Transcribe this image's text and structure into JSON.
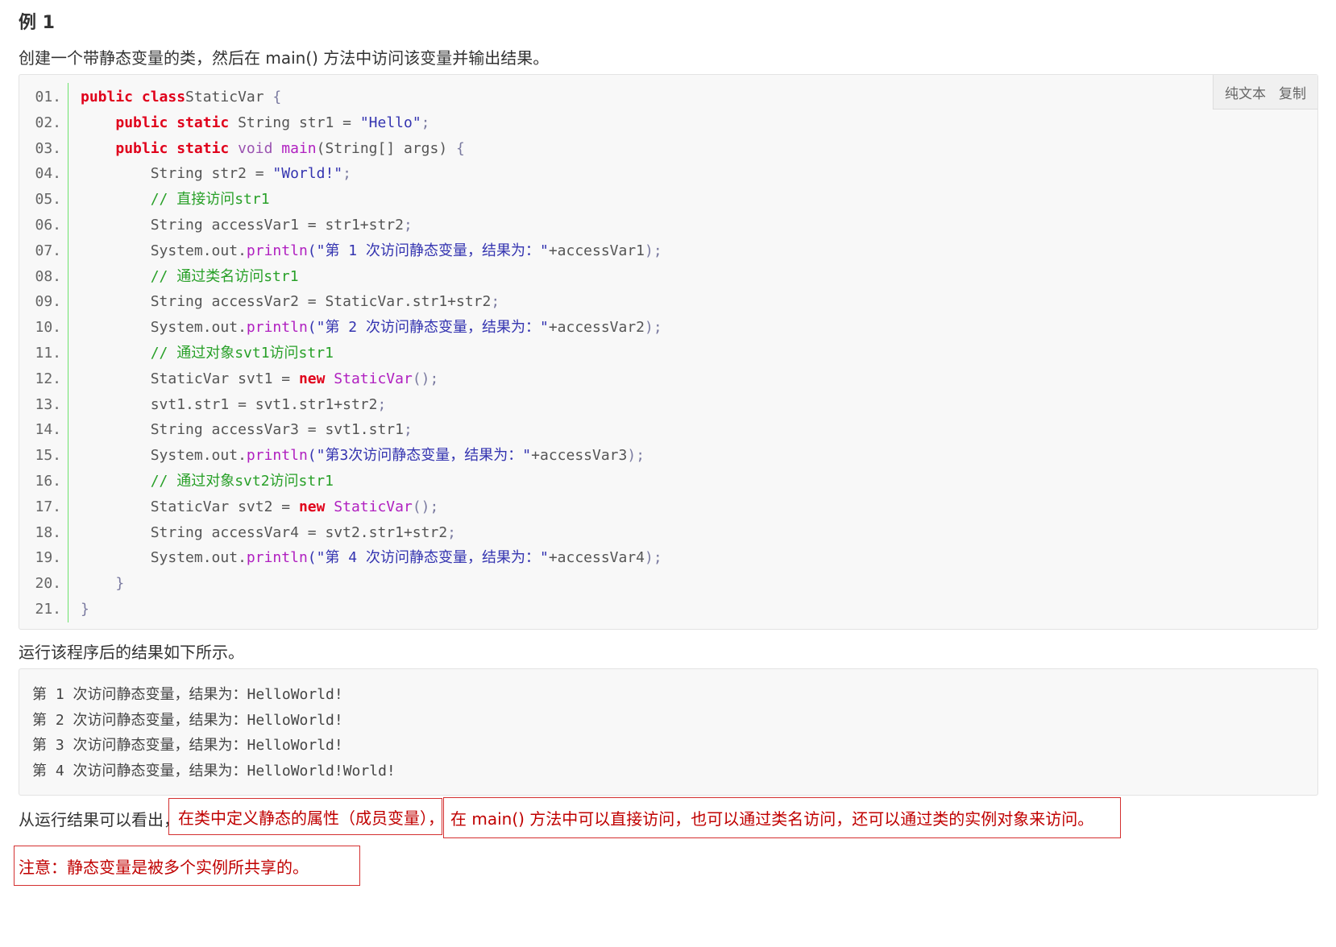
{
  "heading": "例 1",
  "intro": "创建一个带静态变量的类，然后在 main() 方法中访问该变量并输出结果。",
  "toolbar": {
    "plain": "纯文本",
    "copy": "复制"
  },
  "code_lines": [
    {
      "n": "01.",
      "indent": "",
      "tokens": [
        [
          "kw",
          "public class"
        ],
        [
          "",
          "StaticVar "
        ],
        [
          "pu",
          "{"
        ]
      ]
    },
    {
      "n": "02.",
      "indent": "    ",
      "tokens": [
        [
          "kw",
          "public static"
        ],
        [
          "",
          " String str1 = "
        ],
        [
          "st",
          "\"Hello\""
        ],
        [
          "pu",
          ";"
        ]
      ]
    },
    {
      "n": "03.",
      "indent": "    ",
      "tokens": [
        [
          "kw",
          "public static"
        ],
        [
          "ty",
          " void "
        ],
        [
          "fn",
          "main"
        ],
        [
          "",
          "(String[] args) "
        ],
        [
          "pu",
          "{"
        ]
      ]
    },
    {
      "n": "04.",
      "indent": "        ",
      "tokens": [
        [
          "",
          "String str2 = "
        ],
        [
          "st",
          "\"World!\""
        ],
        [
          "pu",
          ";"
        ]
      ]
    },
    {
      "n": "05.",
      "indent": "        ",
      "tokens": [
        [
          "cm",
          "// 直接访问str1"
        ]
      ]
    },
    {
      "n": "06.",
      "indent": "        ",
      "tokens": [
        [
          "",
          "String accessVar1 = str1+str2"
        ],
        [
          "pu",
          ";"
        ]
      ]
    },
    {
      "n": "07.",
      "indent": "        ",
      "tokens": [
        [
          "",
          "System.out."
        ],
        [
          "fn",
          "println"
        ],
        [
          "st",
          "(\"第 1 次访问静态变量，结果为：\""
        ],
        [
          "",
          "+accessVar1"
        ],
        [
          "pu",
          ");"
        ]
      ]
    },
    {
      "n": "08.",
      "indent": "        ",
      "tokens": [
        [
          "cm",
          "// 通过类名访问str1"
        ]
      ]
    },
    {
      "n": "09.",
      "indent": "        ",
      "tokens": [
        [
          "",
          "String accessVar2 = StaticVar.str1+str2"
        ],
        [
          "pu",
          ";"
        ]
      ]
    },
    {
      "n": "10.",
      "indent": "        ",
      "tokens": [
        [
          "",
          "System.out."
        ],
        [
          "fn",
          "println"
        ],
        [
          "st",
          "(\"第 2 次访问静态变量，结果为：\""
        ],
        [
          "",
          "+accessVar2"
        ],
        [
          "pu",
          ");"
        ]
      ]
    },
    {
      "n": "11.",
      "indent": "        ",
      "tokens": [
        [
          "cm",
          "// 通过对象svt1访问str1"
        ]
      ]
    },
    {
      "n": "12.",
      "indent": "        ",
      "tokens": [
        [
          "",
          "StaticVar svt1 = "
        ],
        [
          "kw",
          "new"
        ],
        [
          "fn",
          " StaticVar"
        ],
        [
          "pu",
          "();"
        ]
      ]
    },
    {
      "n": "13.",
      "indent": "        ",
      "tokens": [
        [
          "",
          "svt1.str1 = svt1.str1+str2"
        ],
        [
          "pu",
          ";"
        ]
      ]
    },
    {
      "n": "14.",
      "indent": "        ",
      "tokens": [
        [
          "",
          "String accessVar3 = svt1.str1"
        ],
        [
          "pu",
          ";"
        ]
      ]
    },
    {
      "n": "15.",
      "indent": "        ",
      "tokens": [
        [
          "",
          "System.out."
        ],
        [
          "fn",
          "println"
        ],
        [
          "st",
          "(\"第3次访问静态变量，结果为：\""
        ],
        [
          "",
          "+accessVar3"
        ],
        [
          "pu",
          ");"
        ]
      ]
    },
    {
      "n": "16.",
      "indent": "        ",
      "tokens": [
        [
          "cm",
          "// 通过对象svt2访问str1"
        ]
      ]
    },
    {
      "n": "17.",
      "indent": "        ",
      "tokens": [
        [
          "",
          "StaticVar svt2 = "
        ],
        [
          "kw",
          "new"
        ],
        [
          "fn",
          " StaticVar"
        ],
        [
          "pu",
          "();"
        ]
      ]
    },
    {
      "n": "18.",
      "indent": "        ",
      "tokens": [
        [
          "",
          "String accessVar4 = svt2.str1+str2"
        ],
        [
          "pu",
          ";"
        ]
      ]
    },
    {
      "n": "19.",
      "indent": "        ",
      "tokens": [
        [
          "",
          "System.out."
        ],
        [
          "fn",
          "println"
        ],
        [
          "st",
          "(\"第 4 次访问静态变量，结果为：\""
        ],
        [
          "",
          "+accessVar4"
        ],
        [
          "pu",
          ");"
        ]
      ]
    },
    {
      "n": "20.",
      "indent": "    ",
      "tokens": [
        [
          "pu",
          "}"
        ]
      ]
    },
    {
      "n": "21.",
      "indent": "",
      "tokens": [
        [
          "pu",
          "}"
        ]
      ]
    }
  ],
  "result_intro": "运行该程序后的结果如下所示。",
  "output_lines": [
    "第 1 次访问静态变量，结果为：HelloWorld!",
    "第 2 次访问静态变量，结果为：HelloWorld!",
    "第 3 次访问静态变量，结果为：HelloWorld!",
    "第 4 次访问静态变量，结果为：HelloWorld!World!"
  ],
  "conclusion": {
    "prefix": "从运行结果可以看出，",
    "box1": "在类中定义静态的属性（成员变量），",
    "box2": "在 main() 方法中可以直接访问，也可以通过类名访问，还可以通过类的实例对象来访问。"
  },
  "note": "注意：静态变量是被多个实例所共享的。"
}
